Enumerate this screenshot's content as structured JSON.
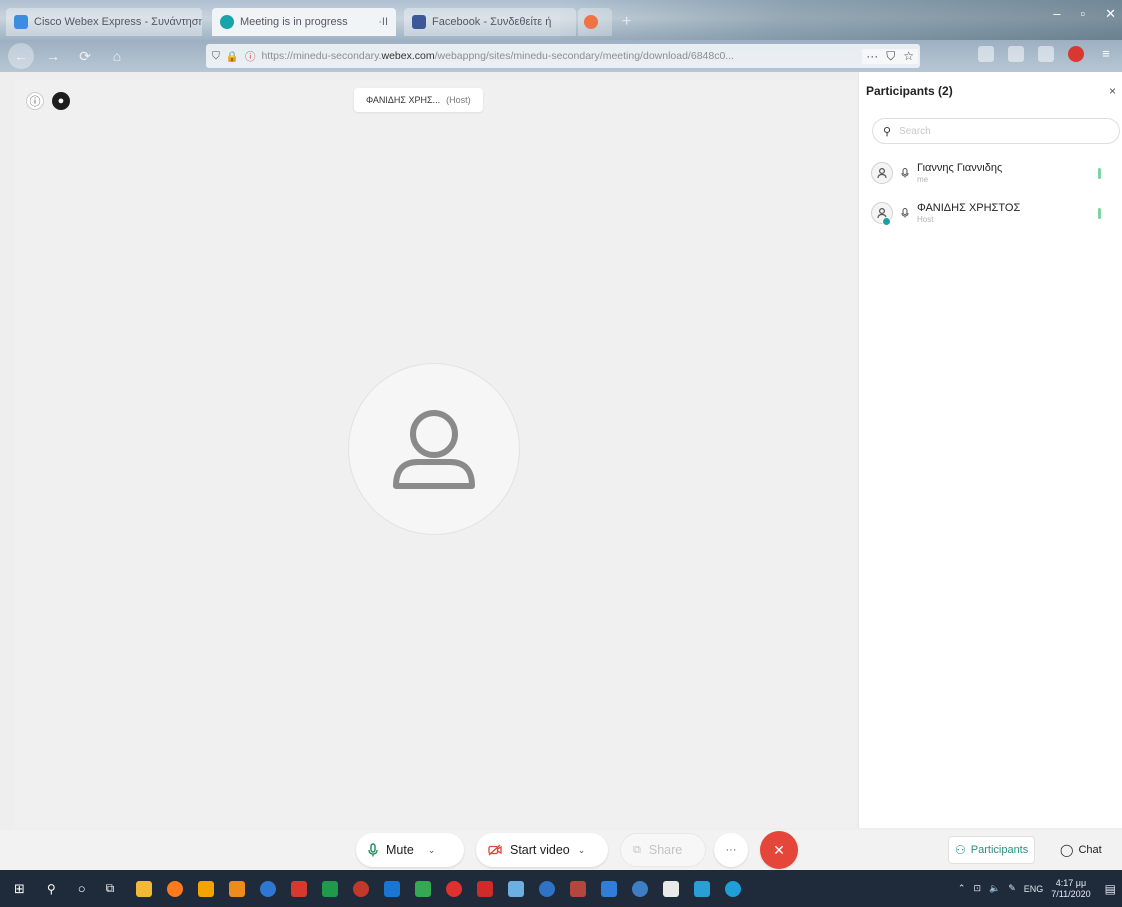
{
  "browser": {
    "tabs": [
      {
        "title": "Cisco Webex Express - Συνάντηση",
        "favicon_color": "#3c8dde"
      },
      {
        "title": "Meeting is in progress",
        "favicon_color": "#1aa3a8",
        "extra": "·II"
      },
      {
        "title": "Facebook - Συνδεθείτε ή",
        "favicon_color": "#3b5998"
      },
      {
        "title": "",
        "favicon_color": "#ff7139"
      }
    ],
    "new_tab_label": "+",
    "window_controls": {
      "minimize": "–",
      "maximize": "▫",
      "close": "✕"
    },
    "url": {
      "prefix": "https://minedu-secondary.",
      "domain": "webex.com",
      "path": "/webappng/sites/minedu-secondary/meeting/download/6848c0..."
    },
    "url_menu": "···"
  },
  "stage": {
    "host_name": "ΦΑΝΙΔΗΣ ΧΡΗΣ...",
    "host_role": "(Host)"
  },
  "participants_panel": {
    "title": "Participants (2)",
    "close": "×",
    "search_placeholder": "Search",
    "participants": [
      {
        "name": "Γιαννης Γιαννιδης",
        "sub": "me"
      },
      {
        "name": "ΦΑΝΙΔΗΣ ΧΡΗΣΤΟΣ",
        "sub": "Host"
      }
    ]
  },
  "controls": {
    "mute": "Mute",
    "start_video": "Start video",
    "share": "Share",
    "more": "···",
    "leave": "✕",
    "participants": "Participants",
    "chat": "Chat",
    "accent_color": "#2c8f84",
    "leave_color": "#e5463a"
  },
  "taskbar": {
    "language": "ENG",
    "time": "4:17 μμ",
    "date": "7/11/2020",
    "app_colors": [
      "#f1b935",
      "#ff7a1a",
      "#f4a300",
      "#ee8b1e",
      "#2e78d3",
      "#d63a2e",
      "#1f9a4a",
      "#c1392b",
      "#1976d2",
      "#34a853",
      "#e03131",
      "#d02b2b",
      "#6bb0e0",
      "#2e73c8",
      "#b3463d",
      "#2f7ed8",
      "#3d7ec4",
      "#e9e9e9",
      "#2a9fd6",
      "#1e9fd8"
    ]
  }
}
